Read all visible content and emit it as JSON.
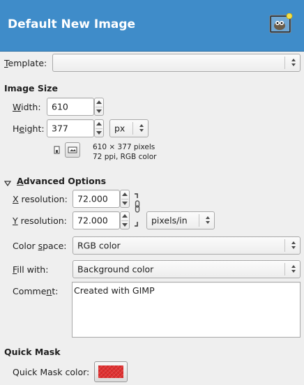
{
  "header": {
    "title": "Default New Image",
    "icon": "wilber-icon"
  },
  "template": {
    "label_prefix": "",
    "label_mnemonic": "T",
    "label_rest": "emplate:",
    "value": ""
  },
  "image_size": {
    "title": "Image Size",
    "width_label_mnemonic": "W",
    "width_label_rest": "idth:",
    "width": "610",
    "height_label_pre": "H",
    "height_label_mnemonic": "e",
    "height_label_rest": "ight:",
    "height": "377",
    "unit": "px",
    "info_line1": "610 × 377 pixels",
    "info_line2": "72 ppi, RGB color"
  },
  "advanced": {
    "title_mnemonic": "A",
    "title_rest": "dvanced Options",
    "xres_label_mnemonic": "X",
    "xres_label_rest": " resolution:",
    "xres": "72.000",
    "yres_label_mnemonic": "Y",
    "yres_label_rest": " resolution:",
    "yres": "72.000",
    "res_unit": "pixels/in",
    "colorspace_label_pre": "Color ",
    "colorspace_label_mnemonic": "s",
    "colorspace_label_rest": "pace:",
    "colorspace": "RGB color",
    "fill_label_mnemonic": "F",
    "fill_label_rest": "ill with:",
    "fill": "Background color",
    "comment_label_pre": "Comme",
    "comment_label_mnemonic": "n",
    "comment_label_rest": "t:",
    "comment": "Created with GIMP"
  },
  "quick_mask": {
    "title": "Quick Mask",
    "color_label": "Quick Mask color:",
    "color": "#e03030"
  },
  "colors": {
    "header_bg": "#3f8cc9",
    "header_text": "#ffffff",
    "window_bg": "#efefef"
  }
}
